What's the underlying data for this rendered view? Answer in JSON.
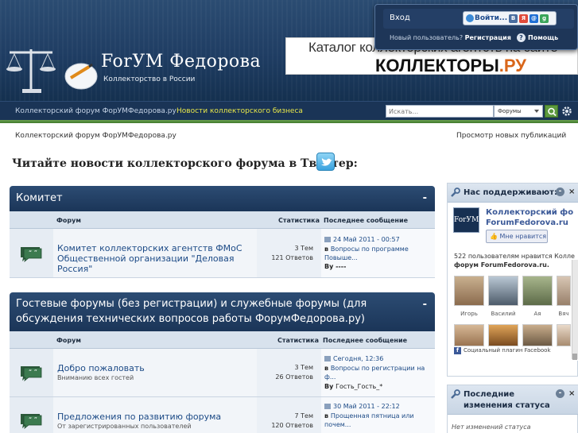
{
  "header": {
    "site_title": "ForУМ Федорова",
    "site_subtitle": "Коллекторство в России",
    "banner_line1": "Каталог коллекторских агентств на сайте",
    "banner_line2_main": "КОЛЛЕКТОРЫ",
    "banner_line2_suffix": ".РУ"
  },
  "login": {
    "label": "Вход",
    "button_label": "Войти...",
    "new_user_prefix": "Новый пользователь? ",
    "register_label": "Регистрация",
    "help_label": "Помощь",
    "social_icons": [
      "vkontakte-icon",
      "yandex-icon",
      "mailru-icon",
      "google-icon"
    ]
  },
  "navbar": {
    "item_1": "Коллекторский форум ФорУМФедорова.ру",
    "item_2": "Новости коллекторского бизнеса",
    "search_placeholder": "Искать...",
    "search_scope": "Форумы"
  },
  "breadcrumb": {
    "home": "Коллекторский форум ФорУМФедорова.ру",
    "new_posts": "Просмотр новых публикаций"
  },
  "twitter": {
    "text": "Читайте новости коллекторского форума в Твиттер:"
  },
  "columns": {
    "forum": "Форум",
    "stats": "Статистика",
    "last_post": "Последнее сообщение"
  },
  "categories": [
    {
      "title": "Комитет",
      "collapse": "-",
      "forums": [
        {
          "title": "Комитет коллекторских агентств ФМоС Общественной организации \"Деловая Россия\"",
          "description": "",
          "topics": "3 Тем",
          "replies": "121 Ответов",
          "last_date": "24 Май 2011 - 00:57",
          "last_topic_prefix": "в ",
          "last_topic": "Вопросы по программе Повыше...",
          "last_by_prefix": "By ",
          "last_by": "----"
        }
      ]
    },
    {
      "title": "Гостевые форумы (без регистрации) и служебные форумы (для обсуждения технических вопросов работы ФорумФедорова.ру)",
      "collapse": "-",
      "forums": [
        {
          "title": "Добро пожаловать",
          "description": "Вниманию всех гостей",
          "topics": "3 Тем",
          "replies": "26 Ответов",
          "last_date": "Сегодня, 12:36",
          "last_topic_prefix": "в ",
          "last_topic": "Вопросы по регистрации на ф...",
          "last_by_prefix": "By ",
          "last_by": "Гость_Гость_*"
        },
        {
          "title": "Предложения по развитию форума",
          "description": "От зарегистрированных пользователей",
          "topics": "7 Тем",
          "replies": "120 Ответов",
          "last_date": "30 Май 2011 - 22:12",
          "last_topic_prefix": "в ",
          "last_topic": "Прощенная пятница или почем...",
          "last_by_prefix": "",
          "last_by": ""
        }
      ]
    }
  ],
  "sidebar": {
    "support": {
      "title": "Нас поддерживают:",
      "minimize": "-",
      "close": "×",
      "fb_page_name_1": "Коллекторский фо",
      "fb_page_name_2": "ForumFedorova.ru",
      "fb_logo": "ForУМ",
      "fb_like": "Мне нравится",
      "fb_count_1": "522 пользователям нравится Колле",
      "fb_count_2": "форум ForumFedorova.ru.",
      "faces": [
        "Игорь",
        "Василий",
        "Ая",
        "Вяч"
      ],
      "fb_plugin": "Социальный плагин Facebook"
    },
    "status": {
      "title": "Последние изменения статуса",
      "minimize": "-",
      "close": "×",
      "empty": "Нет изменений статуса"
    }
  },
  "colors": {
    "header_bg": "#1f3d63",
    "nav_bg": "#1a3456",
    "accent_green": "#5d9a3e",
    "link_blue": "#1c4a86",
    "news_yellow": "#e7e64a"
  }
}
